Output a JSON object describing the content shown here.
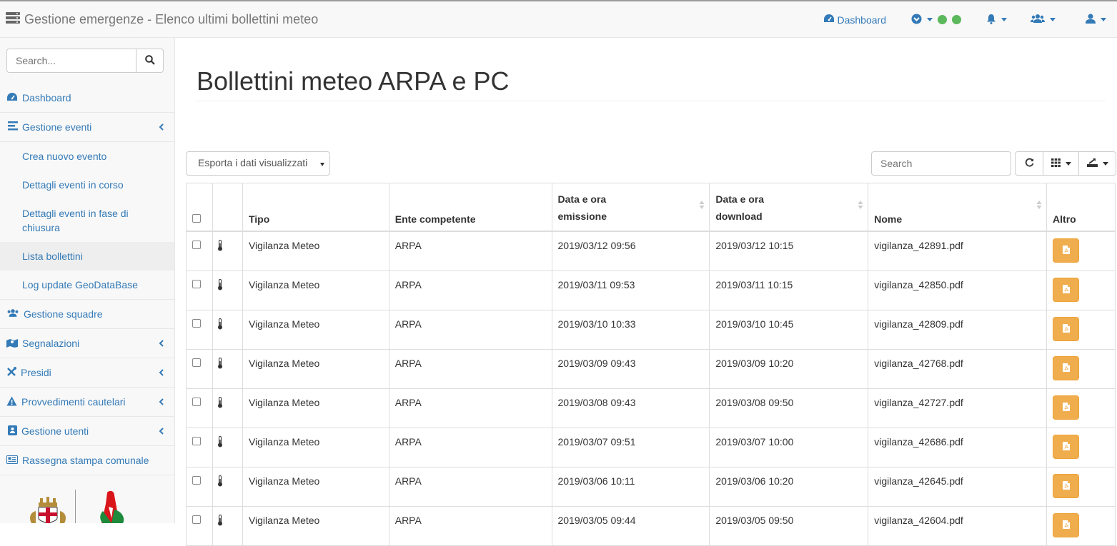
{
  "navbar": {
    "title": "Gestione emergenze - Elenco ultimi bollettini meteo",
    "dashboard_label": "Dashboard"
  },
  "sidebar": {
    "search_placeholder": "Search...",
    "items": [
      {
        "label": "Dashboard",
        "icon": "dashboard-icon"
      },
      {
        "label": "Gestione eventi",
        "icon": "list-icon"
      },
      {
        "label": "Gestione squadre",
        "icon": "users-icon"
      },
      {
        "label": "Segnalazioni",
        "icon": "map-marker-icon"
      },
      {
        "label": "Presidi",
        "icon": "tools-icon"
      },
      {
        "label": "Provvedimenti cautelari",
        "icon": "warning-icon"
      },
      {
        "label": "Gestione utenti",
        "icon": "address-book-icon"
      },
      {
        "label": "Rassegna stampa comunale",
        "icon": "newspaper-icon"
      }
    ],
    "subitems": [
      "Crea nuovo evento",
      "Dettagli eventi in corso",
      "Dettagli eventi in fase di chiusura",
      "Lista bollettini",
      "Log update GeoDataBase"
    ]
  },
  "main": {
    "title": "Bollettini meteo ARPA e PC",
    "export_label": "Esporta i dati visualizzati",
    "table_search_placeholder": "Search",
    "headers": {
      "tipo": "Tipo",
      "ente": "Ente competente",
      "emissione": "Data e ora emissione",
      "download": "Data e ora download",
      "nome": "Nome",
      "altro": "Altro"
    },
    "rows": [
      {
        "tipo": "Vigilanza Meteo",
        "ente": "ARPA",
        "emissione": "2019/03/12 09:56",
        "download": "2019/03/12 10:15",
        "nome": "vigilanza_42891.pdf"
      },
      {
        "tipo": "Vigilanza Meteo",
        "ente": "ARPA",
        "emissione": "2019/03/11 09:53",
        "download": "2019/03/11 10:15",
        "nome": "vigilanza_42850.pdf"
      },
      {
        "tipo": "Vigilanza Meteo",
        "ente": "ARPA",
        "emissione": "2019/03/10 10:33",
        "download": "2019/03/10 10:45",
        "nome": "vigilanza_42809.pdf"
      },
      {
        "tipo": "Vigilanza Meteo",
        "ente": "ARPA",
        "emissione": "2019/03/09 09:43",
        "download": "2019/03/09 10:20",
        "nome": "vigilanza_42768.pdf"
      },
      {
        "tipo": "Vigilanza Meteo",
        "ente": "ARPA",
        "emissione": "2019/03/08 09:43",
        "download": "2019/03/08 09:50",
        "nome": "vigilanza_42727.pdf"
      },
      {
        "tipo": "Vigilanza Meteo",
        "ente": "ARPA",
        "emissione": "2019/03/07 09:51",
        "download": "2019/03/07 10:00",
        "nome": "vigilanza_42686.pdf"
      },
      {
        "tipo": "Vigilanza Meteo",
        "ente": "ARPA",
        "emissione": "2019/03/06 10:11",
        "download": "2019/03/06 10:20",
        "nome": "vigilanza_42645.pdf"
      },
      {
        "tipo": "Vigilanza Meteo",
        "ente": "ARPA",
        "emissione": "2019/03/05 09:44",
        "download": "2019/03/05 09:50",
        "nome": "vigilanza_42604.pdf"
      }
    ]
  },
  "colors": {
    "link": "#337ab7",
    "pdf_button": "#f0ad4e",
    "status_dot": "#5cb85c"
  }
}
